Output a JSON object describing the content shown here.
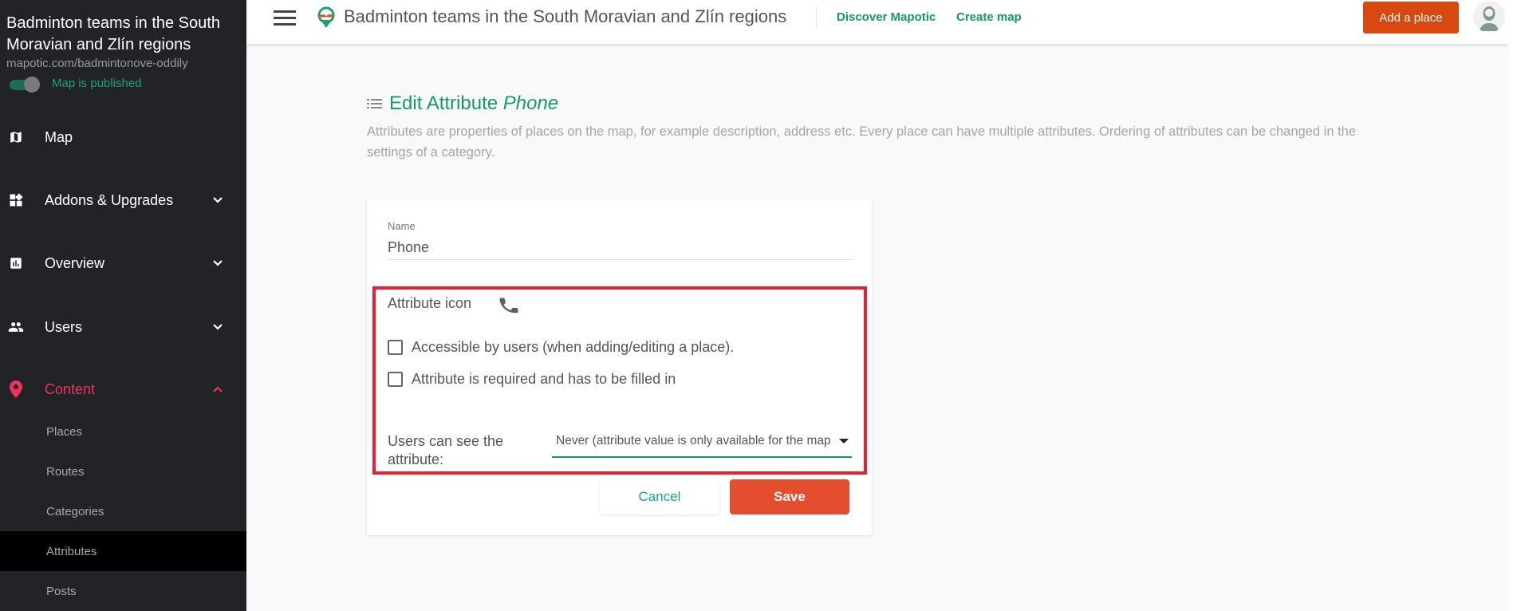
{
  "sidebar": {
    "map_title": "Badminton teams in the South Moravian and Zlín regions",
    "map_url": "mapotic.com/badmintonove-oddily",
    "published_label": "Map is published",
    "published": true,
    "items": [
      {
        "label": "Map",
        "icon": "map-icon"
      },
      {
        "label": "Addons & Upgrades",
        "icon": "widgets-icon",
        "expandable": true
      },
      {
        "label": "Overview",
        "icon": "chart-icon",
        "expandable": true
      },
      {
        "label": "Users",
        "icon": "users-icon",
        "expandable": true
      },
      {
        "label": "Content",
        "icon": "pin-icon",
        "expandable": true,
        "expanded": true,
        "active": true
      }
    ],
    "content_subitems": [
      {
        "label": "Places"
      },
      {
        "label": "Routes"
      },
      {
        "label": "Categories"
      },
      {
        "label": "Attributes",
        "selected": true
      },
      {
        "label": "Posts"
      }
    ]
  },
  "header": {
    "title": "Badminton teams in the South Moravian and Zlín regions",
    "links": [
      "Discover Mapotic",
      "Create map"
    ],
    "add_place_label": "Add a place"
  },
  "main": {
    "title_prefix": "Edit Attribute",
    "title_name": "Phone",
    "description": "Attributes are properties of places on the map, for example description, address etc. Every place can have multiple attributes. Ordering of attributes can be changed in the settings of a category."
  },
  "form": {
    "name_label": "Name",
    "name_value": "Phone",
    "attribute_icon_label": "Attribute icon",
    "attribute_icon": "phone-icon",
    "checkboxes": [
      {
        "label": "Accessible by users (when adding/editing a place).",
        "checked": false
      },
      {
        "label": "Attribute is required and has to be filled in",
        "checked": false
      }
    ],
    "visibility_label": "Users can see the attribute:",
    "visibility_value": "Never (attribute value is only available for the map admin)",
    "cancel_label": "Cancel",
    "save_label": "Save"
  },
  "colors": {
    "brand_green": "#129b62",
    "active_red": "#f0325a",
    "add_button": "#d9480f",
    "save_button": "#e54d2f",
    "highlight": "#e8202f"
  }
}
